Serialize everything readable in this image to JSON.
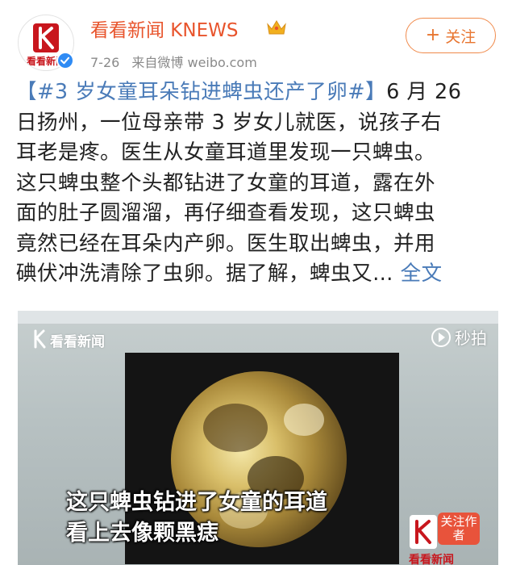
{
  "post": {
    "user_name": "看看新闻 KNEWS",
    "avatar_text": "看看新闻",
    "date": "7-26",
    "source": "来自微博 weibo.com",
    "follow_label": "关注",
    "text_lines": [
      [
        "【#3 岁女童耳朵钻进蜱虫还产了卵#】",
        "6 月 26"
      ],
      "日扬州，一位母亲带 3 岁女儿就医，说孩子右",
      "耳老是疼。医生从女童耳道里发现一只蜱虫。",
      "这只蜱虫整个头都钻进了女童的耳道，露在外",
      "面的肚子圆溜溜，再仔细查看发现，这只蜱虫",
      "竟然已经在耳朵内产卵。医生取出蜱虫，并用",
      [
        "碘伏冲洗清除了虫卵。据了解，蜱虫又…",
        "全文"
      ]
    ]
  },
  "video": {
    "logo_text": "看看新闻",
    "platform": "秒拍",
    "caption_line1": "这只蜱虫钻进了女童的耳道",
    "caption_line2": "看上去像颗黑痣",
    "badge_follow": "关注作者",
    "badge_name": "看看新闻"
  },
  "colors": {
    "accent_orange": "#e8542c",
    "link_blue": "#4a7bb8",
    "brand_red": "#c8161d",
    "verified_blue": "#2f8bf4"
  }
}
